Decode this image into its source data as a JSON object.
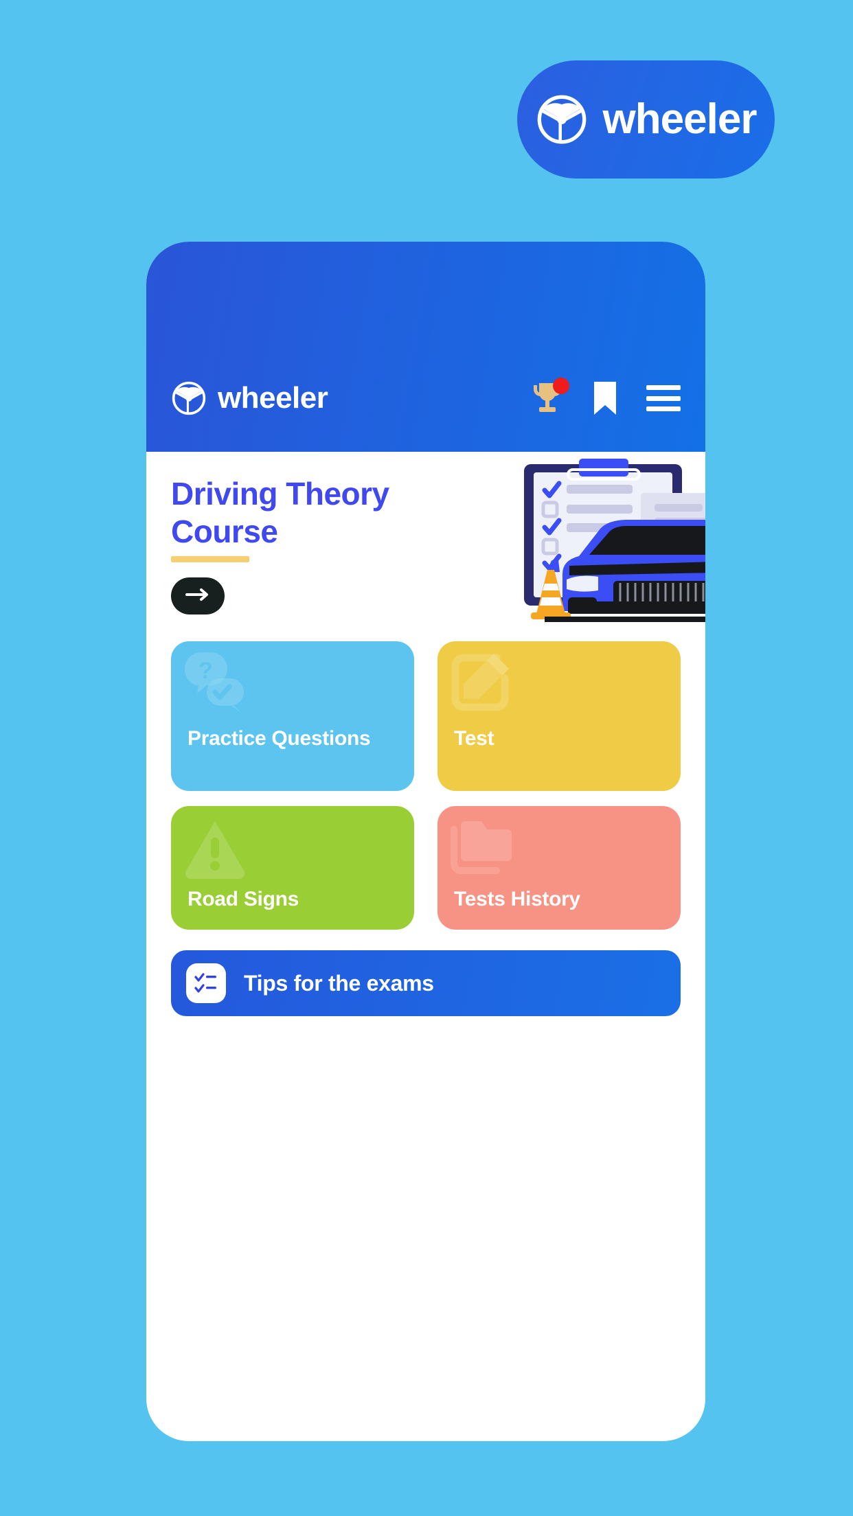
{
  "theme": {
    "page_background": "#55c3f0",
    "brand_blue": "#2558dc",
    "accent_indigo": "#4049f0",
    "underline_yellow": "#f6cf72",
    "cta_dark": "#17201f",
    "badge_red": "#f01b1b",
    "trophy_gold": "#e8c181"
  },
  "brand_pill": {
    "wordmark": "wheeler",
    "icon": "steering-wheel-icon"
  },
  "app": {
    "header": {
      "wordmark": "wheeler",
      "logo_icon": "steering-wheel-icon",
      "actions": [
        {
          "name": "trophy-icon",
          "has_badge": true
        },
        {
          "name": "bookmark-icon",
          "has_badge": false
        },
        {
          "name": "hamburger-menu-icon",
          "has_badge": false
        }
      ]
    },
    "hero": {
      "title_line1": "Driving Theory",
      "title_line2": "Course",
      "cta_icon": "arrow-right-icon",
      "illustration": "clipboard-checklist-car-traffic-cone-illustration"
    },
    "tiles": [
      {
        "label": "Practice Questions",
        "color": "#5cc4ef",
        "icon": "question-chat-bubbles-icon"
      },
      {
        "label": "Test",
        "color": "#f0cc46",
        "icon": "pencil-edit-square-icon"
      },
      {
        "label": "Road Signs",
        "color": "#9ace35",
        "icon": "warning-triangle-icon"
      },
      {
        "label": "Tests History",
        "color": "#f79384",
        "icon": "folder-icon"
      }
    ],
    "tips_banner": {
      "label": "Tips for the exams",
      "icon": "checklist-icon"
    }
  }
}
